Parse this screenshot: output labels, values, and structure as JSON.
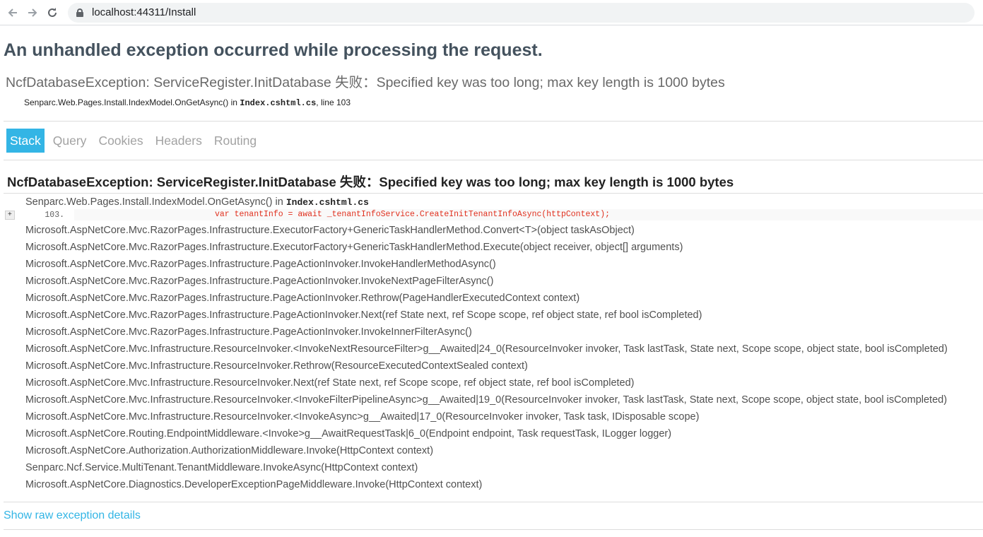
{
  "browser": {
    "back_icon": "arrow-left-icon",
    "forward_icon": "arrow-right-icon",
    "reload_icon": "reload-icon",
    "url": "localhost:44311/Install"
  },
  "error": {
    "title": "An unhandled exception occurred while processing the request.",
    "message": "NcfDatabaseException: ServiceRegister.InitDatabase 失败：Specified key was too long; max key length is 1000 bytes",
    "location_method": "Senparc.Web.Pages.Install.IndexModel.OnGetAsync() in ",
    "location_file": "Index.cshtml.cs",
    "location_line": ", line 103"
  },
  "tabs": [
    "Stack",
    "Query",
    "Cookies",
    "Headers",
    "Routing"
  ],
  "stack": {
    "title": "NcfDatabaseException: ServiceRegister.InitDatabase 失败：Specified key was too long; max key length is 1000 bytes",
    "first_frame_method": "Senparc.Web.Pages.Install.IndexModel.OnGetAsync() in ",
    "first_frame_file": "Index.cshtml.cs",
    "expand_label": "+",
    "source_line_number": "103.",
    "source_line_code": "var tenantInfo = await _tenantInfoService.CreateInitTenantInfoAsync(httpContext);",
    "frames": [
      "Microsoft.AspNetCore.Mvc.RazorPages.Infrastructure.ExecutorFactory+GenericTaskHandlerMethod.Convert<T>(object taskAsObject)",
      "Microsoft.AspNetCore.Mvc.RazorPages.Infrastructure.ExecutorFactory+GenericTaskHandlerMethod.Execute(object receiver, object[] arguments)",
      "Microsoft.AspNetCore.Mvc.RazorPages.Infrastructure.PageActionInvoker.InvokeHandlerMethodAsync()",
      "Microsoft.AspNetCore.Mvc.RazorPages.Infrastructure.PageActionInvoker.InvokeNextPageFilterAsync()",
      "Microsoft.AspNetCore.Mvc.RazorPages.Infrastructure.PageActionInvoker.Rethrow(PageHandlerExecutedContext context)",
      "Microsoft.AspNetCore.Mvc.RazorPages.Infrastructure.PageActionInvoker.Next(ref State next, ref Scope scope, ref object state, ref bool isCompleted)",
      "Microsoft.AspNetCore.Mvc.RazorPages.Infrastructure.PageActionInvoker.InvokeInnerFilterAsync()",
      "Microsoft.AspNetCore.Mvc.Infrastructure.ResourceInvoker.<InvokeNextResourceFilter>g__Awaited|24_0(ResourceInvoker invoker, Task lastTask, State next, Scope scope, object state, bool isCompleted)",
      "Microsoft.AspNetCore.Mvc.Infrastructure.ResourceInvoker.Rethrow(ResourceExecutedContextSealed context)",
      "Microsoft.AspNetCore.Mvc.Infrastructure.ResourceInvoker.Next(ref State next, ref Scope scope, ref object state, ref bool isCompleted)",
      "Microsoft.AspNetCore.Mvc.Infrastructure.ResourceInvoker.<InvokeFilterPipelineAsync>g__Awaited|19_0(ResourceInvoker invoker, Task lastTask, State next, Scope scope, object state, bool isCompleted)",
      "Microsoft.AspNetCore.Mvc.Infrastructure.ResourceInvoker.<InvokeAsync>g__Awaited|17_0(ResourceInvoker invoker, Task task, IDisposable scope)",
      "Microsoft.AspNetCore.Routing.EndpointMiddleware.<Invoke>g__AwaitRequestTask|6_0(Endpoint endpoint, Task requestTask, ILogger logger)",
      "Microsoft.AspNetCore.Authorization.AuthorizationMiddleware.Invoke(HttpContext context)",
      "Senparc.Ncf.Service.MultiTenant.TenantMiddleware.InvokeAsync(HttpContext context)",
      "Microsoft.AspNetCore.Diagnostics.DeveloperExceptionPageMiddleware.Invoke(HttpContext context)"
    ]
  },
  "raw_link": "Show raw exception details",
  "colors": {
    "accent": "#33b5e5",
    "title": "#44525e",
    "code_error": "#e0301e"
  }
}
